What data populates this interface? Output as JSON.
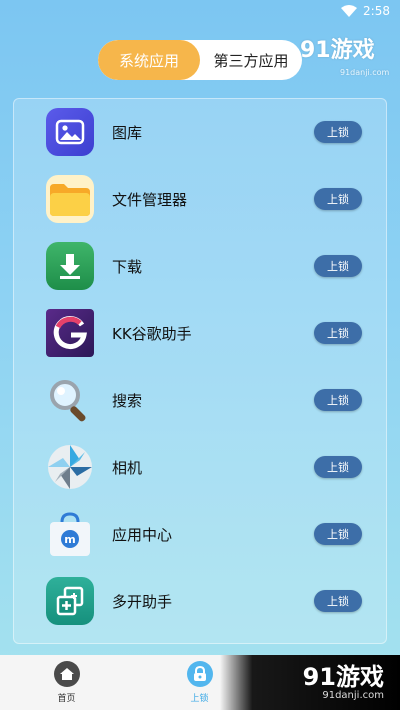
{
  "status": {
    "time": "2:58"
  },
  "tabs": [
    {
      "label": "系统应用",
      "active": true
    },
    {
      "label": "第三方应用",
      "active": false
    }
  ],
  "watermark": {
    "top_logo": "91游戏",
    "top_url": "91danji.com",
    "bottom_logo": "91游戏",
    "bottom_url": "91danji.com"
  },
  "apps": [
    {
      "name": "图库",
      "icon": "gallery-icon",
      "button": "上锁"
    },
    {
      "name": "文件管理器",
      "icon": "folder-icon",
      "button": "上锁"
    },
    {
      "name": "下载",
      "icon": "download-icon",
      "button": "上锁"
    },
    {
      "name": "KK谷歌助手",
      "icon": "google-helper-icon",
      "button": "上锁"
    },
    {
      "name": "搜索",
      "icon": "magnifier-icon",
      "button": "上锁"
    },
    {
      "name": "相机",
      "icon": "camera-aperture-icon",
      "button": "上锁"
    },
    {
      "name": "应用中心",
      "icon": "app-store-bag-icon",
      "button": "上锁"
    },
    {
      "name": "多开助手",
      "icon": "multi-open-icon",
      "button": "上锁"
    }
  ],
  "nav": [
    {
      "label": "首页",
      "icon": "home-icon",
      "active": false
    },
    {
      "label": "上锁",
      "icon": "lock-icon",
      "active": true
    }
  ],
  "colors": {
    "accent_tab": "#f6b64b",
    "lock_button": "#3d6ea8",
    "nav_active": "#3ba9e6"
  }
}
